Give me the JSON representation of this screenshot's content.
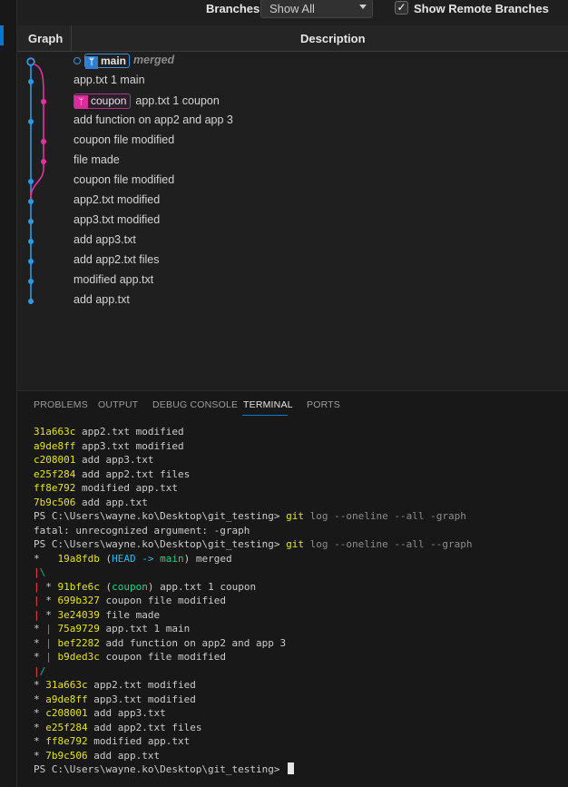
{
  "colors": {
    "main_lane": "#2f9ae0",
    "coupon_lane": "#e0339f",
    "hash": "#e5e510",
    "branch_ref": "#23d18b",
    "head_ref": "#29b8db"
  },
  "toolbar": {
    "branches_label": "Branches:",
    "branch_filter_value": "Show All",
    "show_remote_label": "Show Remote Branches",
    "show_remote_checked": true
  },
  "table": {
    "col_graph": "Graph",
    "col_description": "Description"
  },
  "commits": [
    {
      "text": "merged",
      "ref": "main",
      "lane": "main"
    },
    {
      "text": "app.txt 1 main",
      "lane": "main"
    },
    {
      "text": "app.txt 1 coupon",
      "ref": "coupon",
      "lane": "coupon"
    },
    {
      "text": "add function on app2 and app 3",
      "lane": "main"
    },
    {
      "text": "coupon file modified",
      "lane": "coupon"
    },
    {
      "text": "file made",
      "lane": "coupon"
    },
    {
      "text": "coupon file modified",
      "lane": "main"
    },
    {
      "text": "app2.txt modified",
      "lane": "main"
    },
    {
      "text": "app3.txt modified",
      "lane": "main"
    },
    {
      "text": "add app3.txt",
      "lane": "main"
    },
    {
      "text": "add app2.txt files",
      "lane": "main"
    },
    {
      "text": "modified app.txt",
      "lane": "main"
    },
    {
      "text": "add app.txt",
      "lane": "main"
    }
  ],
  "panel": {
    "tabs": [
      "PROBLEMS",
      "OUTPUT",
      "DEBUG CONSOLE",
      "TERMINAL",
      "PORTS"
    ],
    "active_tab": "TERMINAL"
  },
  "terminal": {
    "prompt": "PS C:\\Users\\wayne.ko\\Desktop\\git_testing>",
    "cmd_git": "git",
    "cmd1_args": "log --oneline --all -graph",
    "cmd2_args": "log --oneline --all --graph",
    "error": "fatal: unrecognized argument: -graph",
    "head_label": "HEAD",
    "arrow": "->",
    "main_label": "main",
    "coupon_label": "coupon",
    "merge_msg": "merged",
    "early_log": [
      {
        "hash": "31a663c",
        "msg": "app2.txt modified"
      },
      {
        "hash": "a9de8ff",
        "msg": "app3.txt modified"
      },
      {
        "hash": "c208001",
        "msg": "add app3.txt"
      },
      {
        "hash": "e25f284",
        "msg": "add app2.txt files"
      },
      {
        "hash": "ff8e792",
        "msg": "modified app.txt"
      },
      {
        "hash": "7b9c506",
        "msg": "add app.txt"
      }
    ],
    "graph_log": [
      {
        "hash": "19a8fdb"
      },
      {
        "hash": "91bfe6c",
        "msg": "app.txt 1 coupon"
      },
      {
        "hash": "699b327",
        "msg": "coupon file modified"
      },
      {
        "hash": "3e24039",
        "msg": "file made"
      },
      {
        "hash": "75a9729",
        "msg": "app.txt 1 main"
      },
      {
        "hash": "bef2282",
        "msg": "add function on app2 and app 3"
      },
      {
        "hash": "b9ded3c",
        "msg": "coupon file modified"
      },
      {
        "hash": "31a663c",
        "msg": "app2.txt modified"
      },
      {
        "hash": "a9de8ff",
        "msg": "app3.txt modified"
      },
      {
        "hash": "c208001",
        "msg": "add app3.txt"
      },
      {
        "hash": "e25f284",
        "msg": "add app2.txt files"
      },
      {
        "hash": "ff8e792",
        "msg": "modified app.txt"
      },
      {
        "hash": "7b9c506",
        "msg": "add app.txt"
      }
    ]
  }
}
